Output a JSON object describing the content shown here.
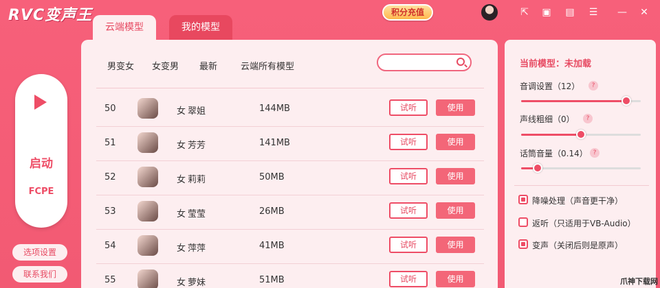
{
  "app": {
    "title": "RVC变声王",
    "credits_label": "积分充值"
  },
  "tabs": [
    {
      "label": "云端模型"
    },
    {
      "label": "我的模型"
    }
  ],
  "sidebar": {
    "start_label": "启动",
    "engine": "FCPE",
    "options_label": "选项设置",
    "contact_label": "联系我们"
  },
  "filters": [
    "男变女",
    "女变男",
    "最新",
    "云端所有模型"
  ],
  "search": {
    "value": "",
    "placeholder": ""
  },
  "models": [
    {
      "num": "50",
      "gender": "女",
      "name": "翠姐",
      "size": "144MB",
      "try": "试听",
      "use": "使用"
    },
    {
      "num": "51",
      "gender": "女",
      "name": "芳芳",
      "size": "141MB",
      "try": "试听",
      "use": "使用"
    },
    {
      "num": "52",
      "gender": "女",
      "name": "莉莉",
      "size": "50MB",
      "try": "试听",
      "use": "使用"
    },
    {
      "num": "53",
      "gender": "女",
      "name": "莹莹",
      "size": "26MB",
      "try": "试听",
      "use": "使用"
    },
    {
      "num": "54",
      "gender": "女",
      "name": "萍萍",
      "size": "41MB",
      "try": "试听",
      "use": "使用"
    },
    {
      "num": "55",
      "gender": "女",
      "name": "萝妹",
      "size": "51MB",
      "try": "试听",
      "use": "使用"
    }
  ],
  "settings": {
    "current_model": "当前模型：未加载",
    "sliders": [
      {
        "label": "音调设置（12）",
        "value": 0.88
      },
      {
        "label": "声线粗细（0）",
        "value": 0.5
      },
      {
        "label": "话筒音量（0.14）",
        "value": 0.14
      }
    ],
    "help": "?",
    "checks": [
      {
        "label": "降噪处理（声音更干净）",
        "checked": true
      },
      {
        "label": "返听（只适用于VB-Audio）",
        "checked": false
      },
      {
        "label": "变声（关闭后则是原声）",
        "checked": true
      }
    ]
  },
  "watermark": "爪神下载网",
  "icons": [
    "export-icon",
    "screen-icon",
    "chat-icon",
    "menu-icon",
    "minimize-icon",
    "close-icon"
  ]
}
